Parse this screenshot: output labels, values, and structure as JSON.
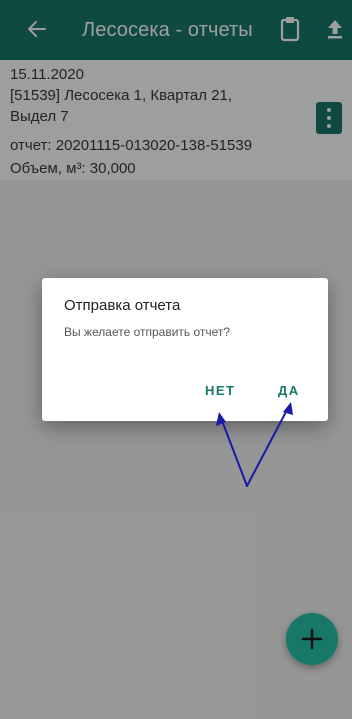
{
  "appbar": {
    "title": "Лесосека - отчеты",
    "back_icon": "arrow-left-icon",
    "clipboard_icon": "clipboard-icon",
    "upload_icon": "upload-icon",
    "color": "#17786a"
  },
  "report_item": {
    "date": "15.11.2020",
    "location_line1": "[51539] Лесосека 1, Квартал 21,",
    "location_line2": "Выдел 7",
    "report_line": "отчет:  20201115-013020-138-51539",
    "volume_line": "Объем, м³:  30,000",
    "menu_icon": "more-vertical-icon"
  },
  "dialog": {
    "title": "Отправка отчета",
    "message": "Вы желаете отправить отчет?",
    "no_label": "НЕТ",
    "yes_label": "ДА"
  },
  "fab": {
    "icon": "plus-icon"
  },
  "colors": {
    "accent": "#17786a",
    "annotation": "#1a1aa8"
  }
}
